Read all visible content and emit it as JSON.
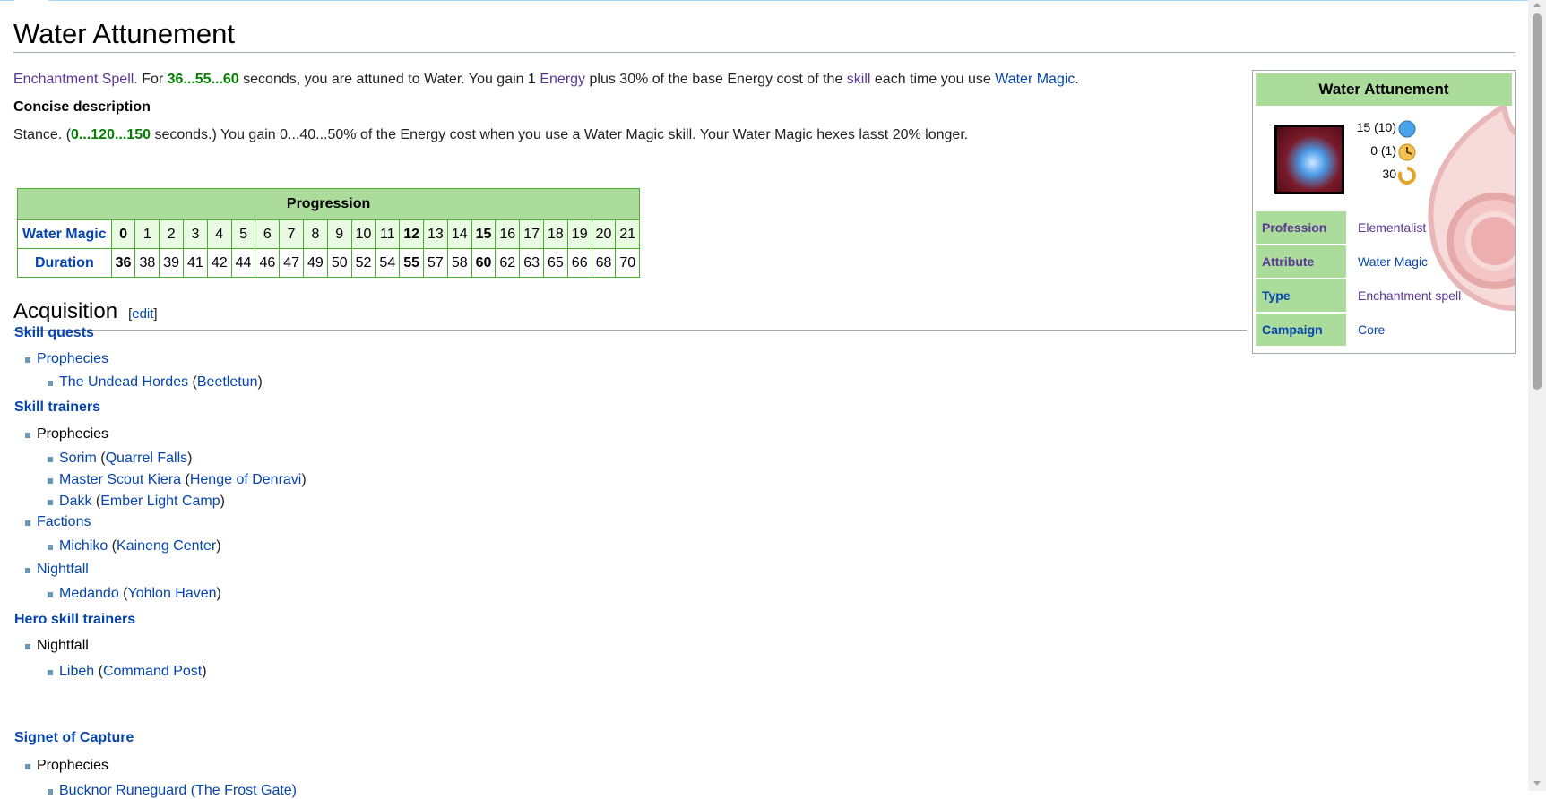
{
  "title": "Water Attunement",
  "intro": {
    "spell_type": "Enchantment Spell.",
    "for": " For ",
    "duration_range": "36...55...60",
    "text1": " seconds, you are attuned to Water. You gain 1 ",
    "energy": "Energy",
    "text2": " plus 30% of the base Energy cost of the ",
    "skill": "skill",
    "text3": " each time you use ",
    "water_magic": "Water Magic",
    "text4": "."
  },
  "concise": {
    "heading": "Concise description",
    "stance": "Stance. (",
    "range": "0...120...150",
    "rest": " seconds.) You gain 0...40...50% of the Energy cost when you use a Water Magic skill. Your Water Magic hexes lasst 20% longer."
  },
  "progression": {
    "caption": "Progression",
    "row1_label": "Water Magic",
    "row2_label": "Duration",
    "levels": [
      "0",
      "1",
      "2",
      "3",
      "4",
      "5",
      "6",
      "7",
      "8",
      "9",
      "10",
      "11",
      "12",
      "13",
      "14",
      "15",
      "16",
      "17",
      "18",
      "19",
      "20",
      "21"
    ],
    "durations": [
      "36",
      "38",
      "39",
      "41",
      "42",
      "44",
      "46",
      "47",
      "49",
      "50",
      "52",
      "54",
      "55",
      "57",
      "58",
      "60",
      "62",
      "63",
      "65",
      "66",
      "68",
      "70"
    ]
  },
  "acquisition": {
    "heading": "Acquisition",
    "edit_open": "[",
    "edit": "edit",
    "edit_close": "]",
    "skill_quests": "Skill quests",
    "sq_prophecies": "Prophecies",
    "sq_quest": "The Undead Hordes",
    "sq_npc": "Beetletun",
    "skill_trainers": "Skill trainers",
    "st_prophecies": "Prophecies",
    "st_sorim": "Sorim",
    "st_quarrel": "Quarrel Falls",
    "st_kiera": "Master Scout Kiera",
    "st_henge": "Henge of Denravi",
    "st_dakk": "Dakk",
    "st_ember": "Ember Light Camp",
    "st_factions": "Factions",
    "st_michiko": "Michiko",
    "st_kaineng": "Kaineng Center",
    "st_nightfall": "Nightfall",
    "st_medando": "Medando",
    "st_yohlon": "Yohlon Haven",
    "hero_trainers": "Hero skill trainers",
    "ht_nightfall": "Nightfall",
    "ht_libeh": "Libeh",
    "ht_command": "Command Post",
    "signet": "Signet of Capture",
    "sc_prophecies": "Prophecies",
    "sc_partial": "Bucknor Runeguard (The Frost Gate)",
    "open_paren": " (",
    "close_paren": ")"
  },
  "infobox": {
    "title": "Water Attunement",
    "energy": "15 (10)",
    "activation": "0 (1)",
    "recharge": "30",
    "rows": [
      {
        "key": "Profession",
        "value": "Elementalist"
      },
      {
        "key": "Attribute",
        "value": "Water Magic"
      },
      {
        "key": "Type",
        "value": "Enchantment spell"
      },
      {
        "key": "Campaign",
        "value": "Core"
      }
    ]
  },
  "colors": {
    "link": "#0645ad",
    "visited": "#5a3696",
    "table_header": "#abdc9c",
    "table_border": "#4caf2e",
    "green_text": "#007f00"
  }
}
